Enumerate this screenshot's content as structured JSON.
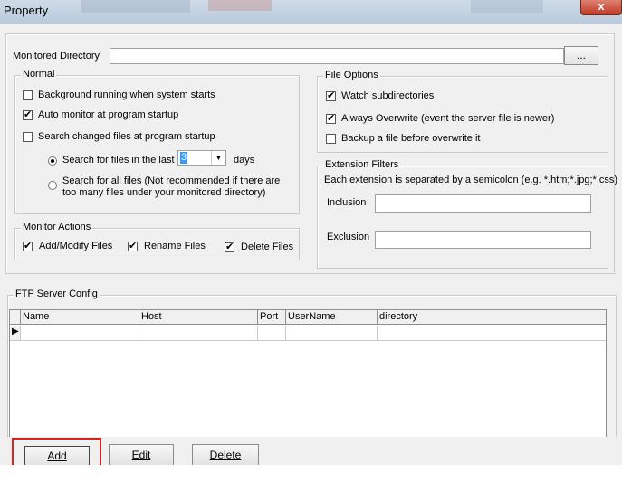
{
  "window": {
    "title": "Property",
    "close_label": "x"
  },
  "monitored_directory": {
    "label": "Monitored Directory",
    "value": "",
    "browse_label": "..."
  },
  "normal": {
    "legend": "Normal",
    "background_running": {
      "label": "Background running when system starts",
      "checked": false
    },
    "auto_monitor": {
      "label": "Auto monitor at program startup",
      "checked": true
    },
    "search_changed": {
      "label": "Search  changed files at program startup",
      "checked": false
    },
    "search_last": {
      "label": "Search for files in the last",
      "value": "3",
      "unit": "days",
      "selected": true
    },
    "search_all": {
      "line1": "Search for all files (Not recommended if there are",
      "line2": "too many files under your monitored directory)",
      "selected": false
    }
  },
  "monitor_actions": {
    "legend": "Monitor Actions",
    "add_modify": {
      "label": "Add/Modify  Files",
      "checked": true
    },
    "rename": {
      "label": "Rename Files",
      "checked": true
    },
    "delete": {
      "label": "Delete Files",
      "checked": true
    }
  },
  "file_options": {
    "legend": "File Options",
    "watch_sub": {
      "label": "Watch subdirectories",
      "checked": true
    },
    "always_overwrite": {
      "label": "Always Overwrite (event the server file is newer)",
      "checked": true
    },
    "backup": {
      "label": "Backup a file before overwrite it",
      "checked": false
    }
  },
  "extension_filters": {
    "legend": "Extension Filters",
    "description": "Each extension is separated by a semicolon (e.g. *.htm;*.jpg;*.css)",
    "inclusion_label": "Inclusion",
    "inclusion_value": "",
    "exclusion_label": "Exclusion",
    "exclusion_value": ""
  },
  "ftp": {
    "legend": "FTP Server Config",
    "columns": [
      "Name",
      "Host",
      "Port",
      "UserName",
      "directory"
    ],
    "rows": [
      [
        "",
        "",
        "",
        "",
        ""
      ]
    ]
  },
  "buttons": {
    "add": "Add",
    "edit": "Edit",
    "delete": "Delete"
  }
}
